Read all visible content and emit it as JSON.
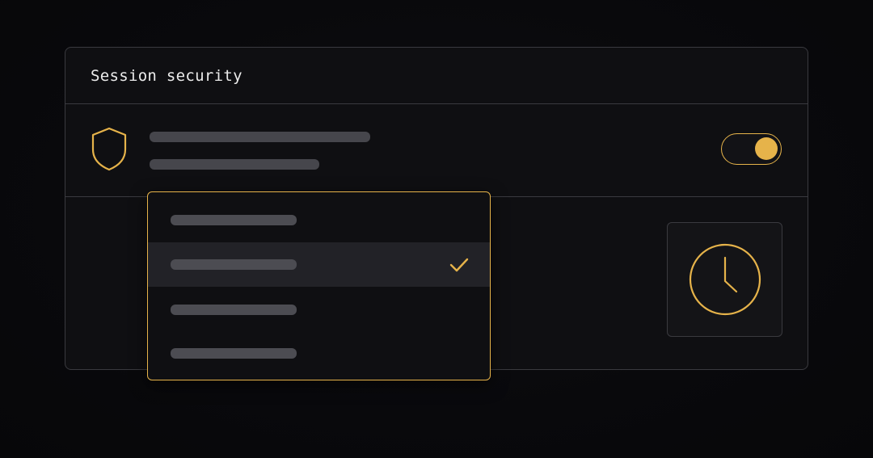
{
  "card": {
    "title": "Session security"
  },
  "setting": {
    "icon": "shield-icon",
    "toggle_on": true
  },
  "dropdown": {
    "options": [
      {
        "selected": false
      },
      {
        "selected": true
      },
      {
        "selected": false
      },
      {
        "selected": false
      }
    ]
  },
  "timeout_tile": {
    "icon": "clock-icon"
  },
  "colors": {
    "accent": "#e6b34a",
    "background": "#0a0a0d",
    "card": "#0f0f12",
    "border": "#3a3a3f",
    "placeholder": "#46464c",
    "selected_row": "#222227",
    "title_text": "#ececec"
  }
}
